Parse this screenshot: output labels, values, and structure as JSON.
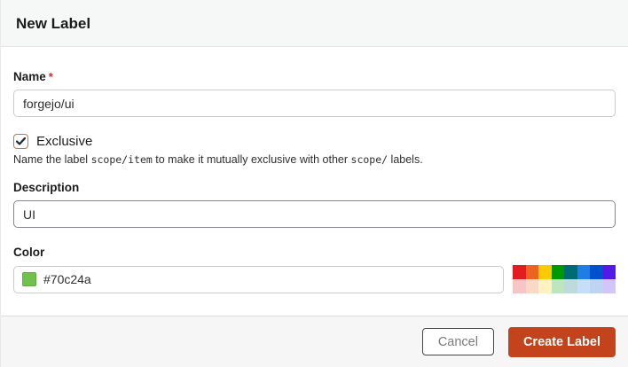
{
  "header": {
    "title": "New Label"
  },
  "form": {
    "name": {
      "label": "Name",
      "required_marker": "*",
      "value": "forgejo/ui"
    },
    "exclusive": {
      "label": "Exclusive",
      "checked": true,
      "help_prefix": "Name the label ",
      "help_code1": "scope/item",
      "help_mid": " to make it mutually exclusive with other ",
      "help_code2": "scope/",
      "help_suffix": " labels."
    },
    "description": {
      "label": "Description",
      "value": "UI"
    },
    "color": {
      "label": "Color",
      "value": "#70c24a",
      "swatch_color": "#70c24a",
      "presets": [
        [
          "#e11d21",
          "#eb6420",
          "#fbca04",
          "#009800",
          "#006b75",
          "#207de5",
          "#0052cc",
          "#5319e7"
        ],
        [
          "#f6c6c7",
          "#fad8c7",
          "#fef2c0",
          "#bfe5bf",
          "#bfdadc",
          "#c7def8",
          "#bfd4f2",
          "#d4c5f9"
        ]
      ]
    }
  },
  "footer": {
    "cancel_label": "Cancel",
    "submit_label": "Create Label",
    "submit_color": "#c2431c"
  }
}
